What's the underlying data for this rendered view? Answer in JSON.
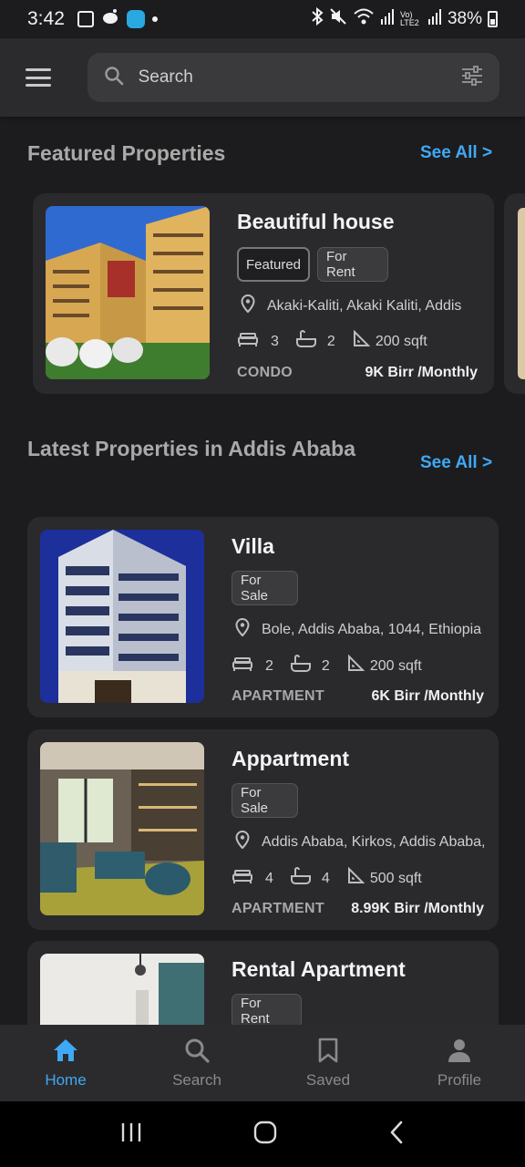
{
  "status_bar": {
    "time": "3:42",
    "network": "Vo) LTE2",
    "battery": "38%"
  },
  "search": {
    "placeholder": "Search"
  },
  "featured": {
    "title": "Featured Properties",
    "see_all": "See All >",
    "cards": [
      {
        "title": "Beautiful house",
        "tags": [
          "Featured",
          "For Rent"
        ],
        "location": "Akaki-Kaliti, Akaki Kaliti, Addis",
        "beds": "3",
        "baths": "2",
        "area": "200 sqft",
        "type": "CONDO",
        "price": "9K Birr /Monthly"
      }
    ]
  },
  "latest": {
    "title": "Latest Properties in Addis Ababa",
    "see_all": "See All >",
    "cards": [
      {
        "title": "Villa",
        "tag": "For Sale",
        "location": "Bole, Addis Ababa, 1044, Ethiopia",
        "beds": "2",
        "baths": "2",
        "area": "200 sqft",
        "type": "APARTMENT",
        "price": "6K Birr /Monthly"
      },
      {
        "title": "Appartment",
        "tag": "For Sale",
        "location": "Addis Ababa, Kirkos, Addis Ababa,",
        "beds": "4",
        "baths": "4",
        "area": "500 sqft",
        "type": "APARTMENT",
        "price": "8.99K Birr /Monthly"
      },
      {
        "title": "Rental Apartment",
        "tag": "For Rent"
      }
    ]
  },
  "bottom_nav": [
    {
      "label": "Home",
      "icon": "home-icon",
      "active": true
    },
    {
      "label": "Search",
      "icon": "search-icon",
      "active": false
    },
    {
      "label": "Saved",
      "icon": "bookmark-icon",
      "active": false
    },
    {
      "label": "Profile",
      "icon": "person-icon",
      "active": false
    }
  ],
  "colors": {
    "accent": "#3fa9f5",
    "background": "#1c1c1e",
    "card": "#2a2a2d"
  }
}
